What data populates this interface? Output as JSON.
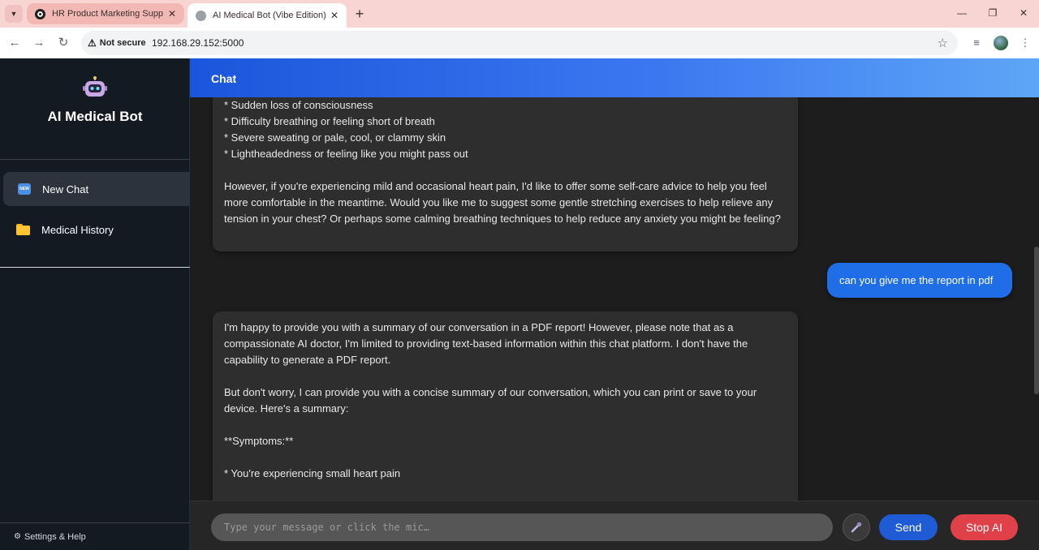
{
  "browser": {
    "tabs": [
      {
        "title": "HR Product Marketing Support"
      },
      {
        "title": "AI Medical Bot (Vibe Edition)"
      }
    ],
    "security_label": "Not secure",
    "url": "192.168.29.152:5000"
  },
  "sidebar": {
    "app_title": "AI Medical Bot",
    "badge_text": "NEW",
    "items": [
      {
        "label": "New Chat"
      },
      {
        "label": "Medical History"
      }
    ],
    "footer": "Settings & Help"
  },
  "header": {
    "title": "Chat"
  },
  "messages": [
    {
      "role": "bot",
      "text": "* Sudden loss of consciousness\n* Difficulty breathing or feeling short of breath\n* Severe sweating or pale, cool, or clammy skin\n* Lightheadedness or feeling like you might pass out\n\nHowever, if you're experiencing mild and occasional heart pain, I'd like to offer some self-care advice to help you feel more comfortable in the meantime. Would you like me to suggest some gentle stretching exercises to help relieve any tension in your chest? Or perhaps some calming breathing techniques to help reduce any anxiety you might be feeling?"
    },
    {
      "role": "user",
      "text": "can you give me the report in pdf"
    },
    {
      "role": "bot",
      "text": "I'm happy to provide you with a summary of our conversation in a PDF report! However, please note that as a compassionate AI doctor, I'm limited to providing text-based information within this chat platform. I don't have the capability to generate a PDF report.\n\nBut don't worry, I can provide you with a concise summary of our conversation, which you can print or save to your device. Here's a summary:\n\n**Symptoms:**\n\n* You're experiencing small heart pain"
    }
  ],
  "input": {
    "placeholder": "Type your message or click the mic…",
    "value": ""
  },
  "buttons": {
    "send": "Send",
    "stop": "Stop AI"
  },
  "colors": {
    "accent": "#1f5bd4",
    "stop": "#e04048",
    "user_bubble": "#1f6ee8",
    "sidebar_bg": "#141a22"
  }
}
